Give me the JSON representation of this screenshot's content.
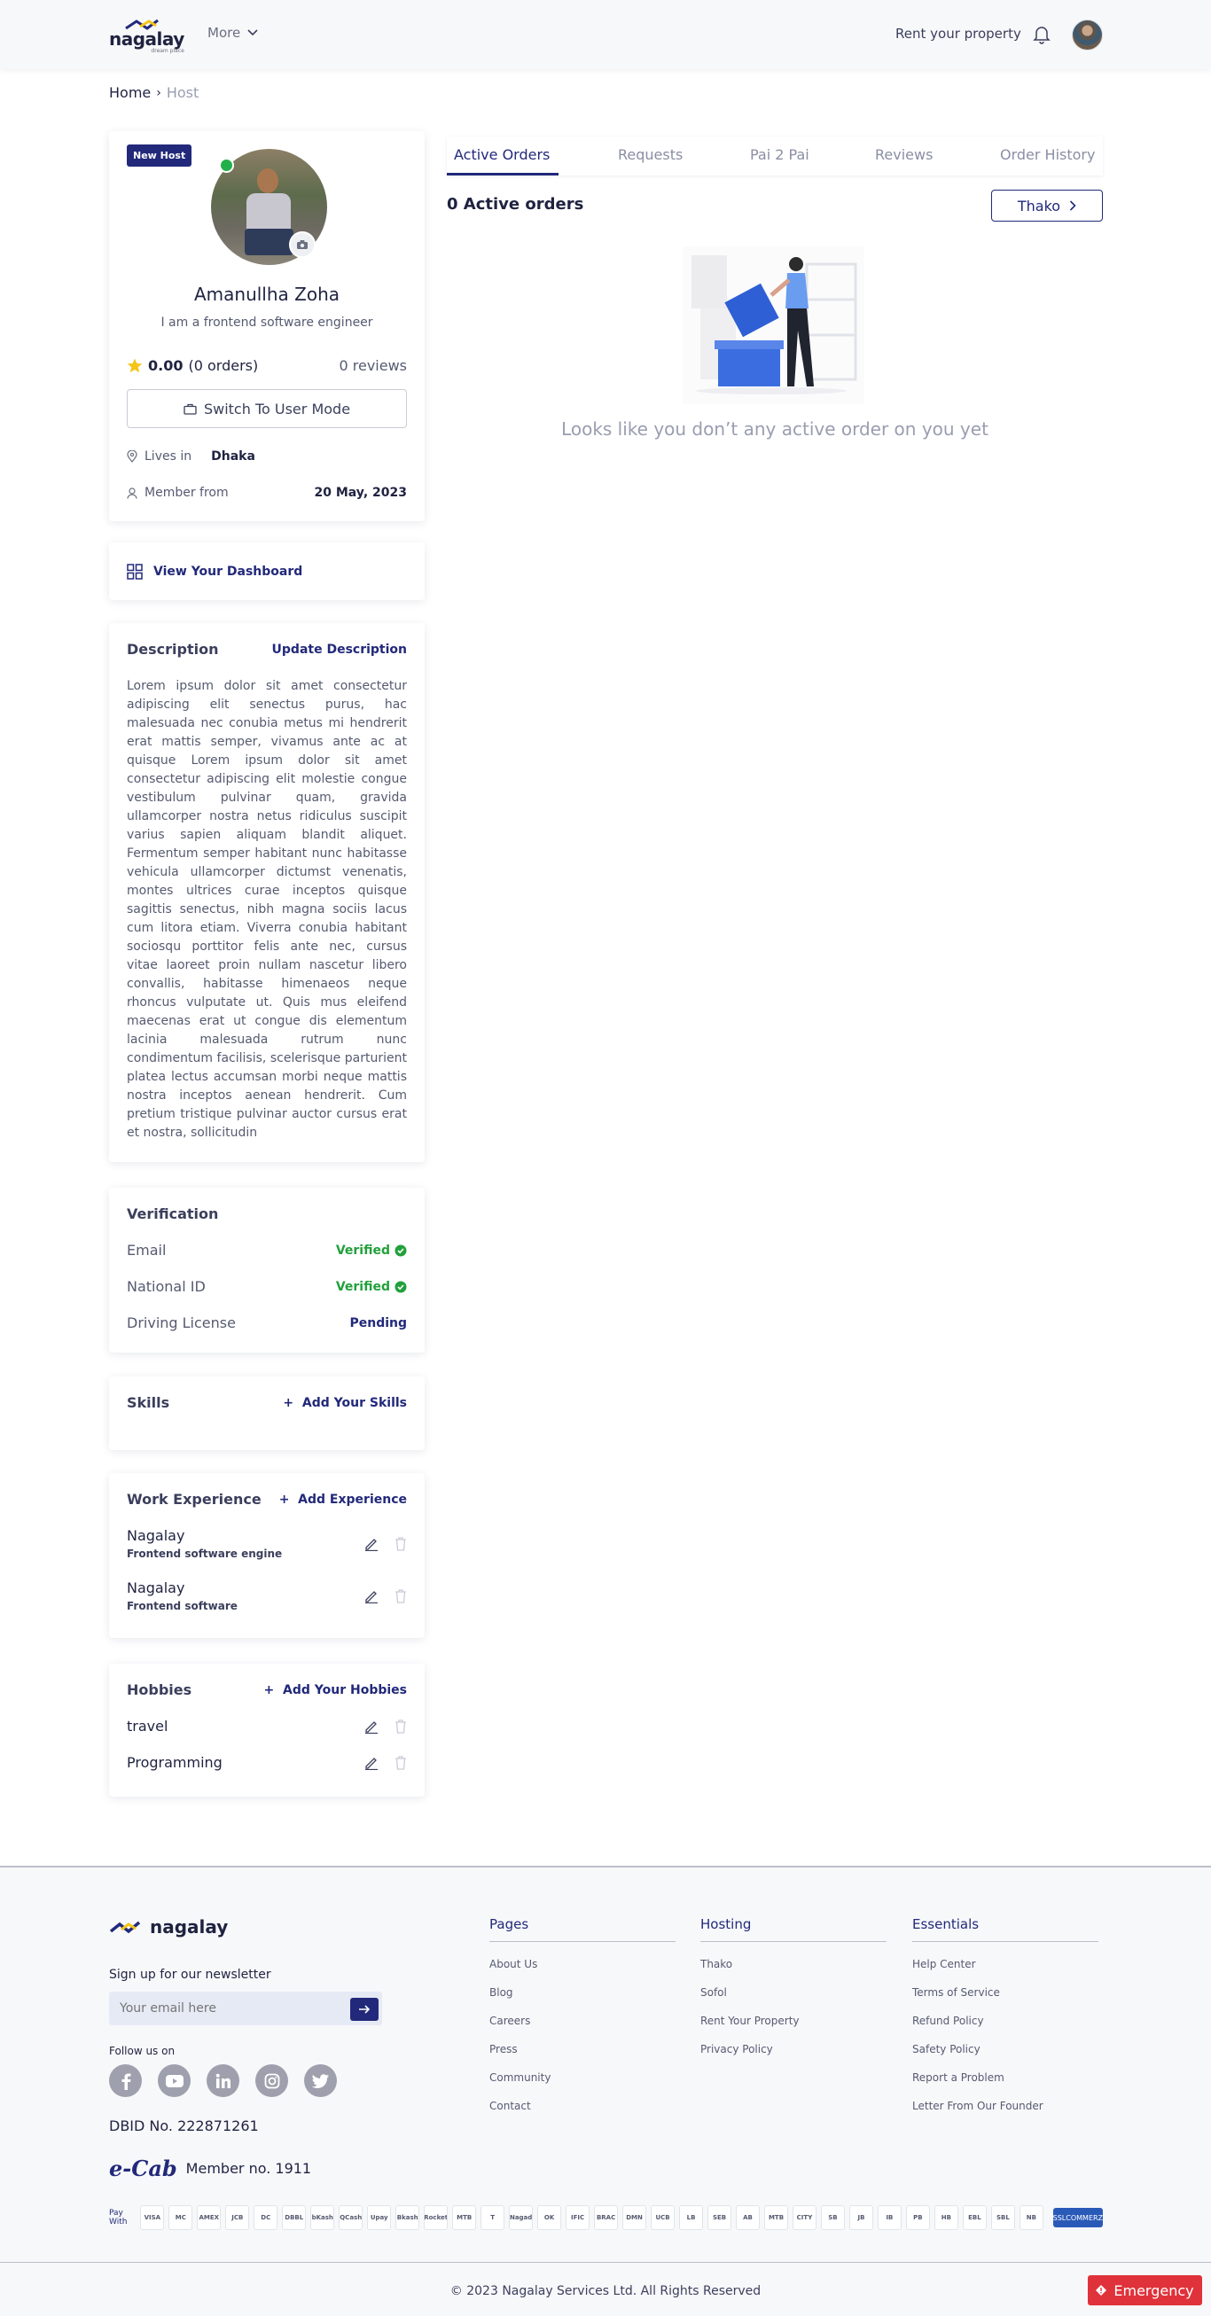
{
  "header": {
    "logo_text": "nagalay",
    "logo_tagline": "dream place",
    "more_label": "More",
    "rent_label": "Rent your property"
  },
  "breadcrumb": {
    "home": "Home",
    "current": "Host"
  },
  "profile": {
    "badge": "New Host",
    "name": "Amanullha Zoha",
    "bio": "I am a frontend software engineer",
    "rating": "0.00",
    "orders": "(0 orders)",
    "reviews": "0 reviews",
    "switch_label": "Switch To User Mode",
    "lives_label": "Lives in",
    "city": "Dhaka",
    "member_label": "Member from",
    "member_date": "20 May, 2023"
  },
  "dashboard_label": "View Your Dashboard",
  "description": {
    "title": "Description",
    "action": "Update Description",
    "text": "Lorem ipsum dolor sit amet consectetur adipiscing elit senectus purus, hac malesuada nec conubia metus mi hendrerit erat mattis semper, vivamus ante ac at quisque Lorem ipsum dolor sit amet consectetur adipiscing elit molestie congue vestibulum pulvinar quam, gravida ullamcorper nostra netus ridiculus suscipit varius sapien aliquam blandit aliquet. Fermentum semper habitant nunc habitasse vehicula ullamcorper dictumst venenatis, montes ultrices curae inceptos quisque sagittis senectus, nibh magna sociis lacus cum litora etiam. Viverra conubia habitant sociosqu porttitor felis ante nec, cursus vitae laoreet proin nullam nascetur libero convallis, habitasse himenaeos neque rhoncus vulputate ut. Quis mus eleifend maecenas erat ut congue dis elementum lacinia malesuada rutrum nunc condimentum facilisis, scelerisque parturient platea lectus accumsan morbi neque mattis nostra inceptos aenean hendrerit. Cum pretium tristique pulvinar auctor cursus erat et nostra, sollicitudin"
  },
  "verification": {
    "title": "Verification",
    "items": [
      {
        "label": "Email",
        "status": "Verified"
      },
      {
        "label": "National ID",
        "status": "Verified"
      },
      {
        "label": "Driving License",
        "status": "Pending"
      }
    ]
  },
  "skills": {
    "title": "Skills",
    "action": "Add Your Skills"
  },
  "work": {
    "title": "Work Experience",
    "action": "Add Experience",
    "items": [
      {
        "company": "Nagalay",
        "role": "Frontend software engine"
      },
      {
        "company": "Nagalay",
        "role": "Frontend software"
      }
    ]
  },
  "hobbies": {
    "title": "Hobbies",
    "action": "Add Your Hobbies",
    "items": [
      {
        "name": "travel"
      },
      {
        "name": "Programming"
      }
    ]
  },
  "tabs": [
    "Active Orders",
    "Requests",
    "Pai 2 Pai",
    "Reviews",
    "Order History"
  ],
  "orders": {
    "count_label": "0 Active orders",
    "filter_label": "Thako",
    "empty_message": "Looks like you don’t any active order on you yet"
  },
  "footer": {
    "logo_text": "nagalay",
    "newsletter_title": "Sign up for our newsletter",
    "email_placeholder": "Your email here",
    "follow_label": "Follow us on",
    "dbid": "DBID No. 222871261",
    "ecab_logo": "e-Cab",
    "ecab_member": "Member no. 1911",
    "columns": [
      {
        "title": "Pages",
        "links": [
          "About Us",
          "Blog",
          "Careers",
          "Press",
          "Community",
          "Contact"
        ]
      },
      {
        "title": "Hosting",
        "links": [
          "Thako",
          "Sofol",
          "Rent Your Property",
          "Privacy Policy"
        ]
      },
      {
        "title": "Essentials",
        "links": [
          "Help Center",
          "Terms of Service",
          "Refund Policy",
          "Safety Policy",
          "Report a Problem",
          "Letter From Our Founder"
        ]
      }
    ],
    "pay_label": "Pay With",
    "payment_methods": [
      "VISA",
      "MC",
      "AMEX",
      "JCB",
      "DC",
      "DBBL",
      "bKash",
      "QCash",
      "Upay",
      "Bkash",
      "Rocket",
      "MTB",
      "T",
      "Nagad",
      "OK",
      "IFIC",
      "BRAC",
      "DMN",
      "UCB",
      "LB",
      "SEB",
      "AB",
      "MTB",
      "CITY",
      "SB",
      "JB",
      "IB",
      "PB",
      "HB",
      "EBL",
      "SBL",
      "NB"
    ],
    "ssl_label": "SSLCOMMERZ",
    "copyright": "© 2023 Nagalay Services Ltd. All Rights Reserved"
  },
  "emergency_label": "Emergency",
  "colors": {
    "primary": "#22297a",
    "success": "#22a03c",
    "danger": "#e0323a",
    "accent": "#f5c518"
  }
}
